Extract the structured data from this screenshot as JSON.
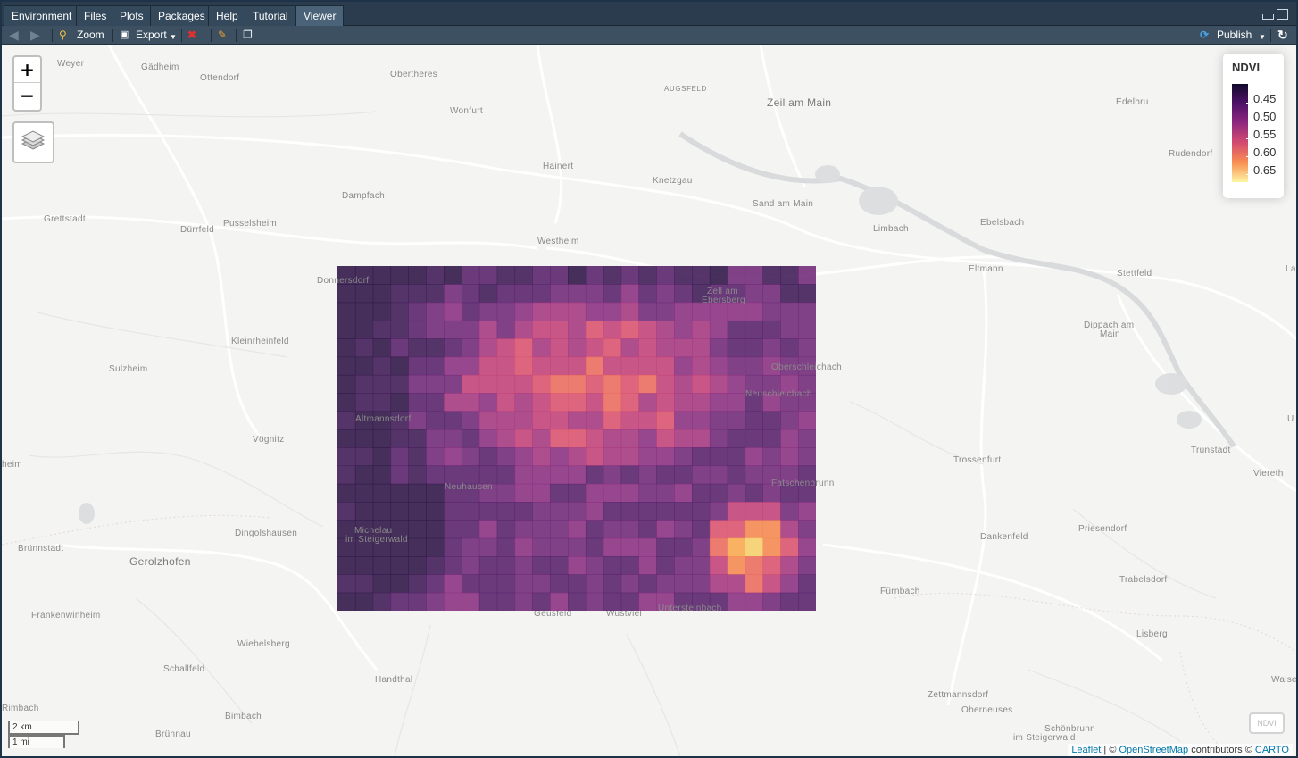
{
  "tabs": [
    {
      "label": "Environment",
      "active": false
    },
    {
      "label": "Files",
      "active": false
    },
    {
      "label": "Plots",
      "active": false
    },
    {
      "label": "Packages",
      "active": false
    },
    {
      "label": "Help",
      "active": false
    },
    {
      "label": "Tutorial",
      "active": false
    },
    {
      "label": "Viewer",
      "active": true
    }
  ],
  "toolbar": {
    "zoom_label": "Zoom",
    "export_label": "Export",
    "publish_label": "Publish"
  },
  "map": {
    "zoom_in": "+",
    "zoom_out": "−",
    "legend": {
      "title": "NDVI",
      "labels": [
        "0.45",
        "0.50",
        "0.55",
        "0.60",
        "0.65"
      ],
      "colors": [
        "#0d0887",
        "#3b0f70",
        "#8c2981",
        "#de4968",
        "#fe9f6d",
        "#fcfdbf"
      ]
    },
    "scale": {
      "metric": "2 km",
      "imperial": "1 mi"
    },
    "layer_toggle": "NDVI",
    "attribution": {
      "leaflet": "Leaflet",
      "sep": " | © ",
      "osm": "OpenStreetMap",
      "mid": " contributors © ",
      "carto": "CARTO"
    },
    "places": [
      {
        "name": "Weyer"
      },
      {
        "name": "Gädheim"
      },
      {
        "name": "Ottendorf"
      },
      {
        "name": "Obertheres"
      },
      {
        "name": "AUGSFELD"
      },
      {
        "name": "Zeil am Main"
      },
      {
        "name": "Edelbru"
      },
      {
        "name": "Wonfurt"
      },
      {
        "name": "Rudendorf"
      },
      {
        "name": "Hainert"
      },
      {
        "name": "Knetzgau"
      },
      {
        "name": "Sand am Main"
      },
      {
        "name": "Dampfach"
      },
      {
        "name": "Grettstadt"
      },
      {
        "name": "Dürrfeld"
      },
      {
        "name": "Pusselsheim"
      },
      {
        "name": "Limbach"
      },
      {
        "name": "Ebelsbach"
      },
      {
        "name": "Westheim"
      },
      {
        "name": "Eltmann"
      },
      {
        "name": "Stettfeld"
      },
      {
        "name": "Donnersdorf"
      },
      {
        "name": "Zell am"
      },
      {
        "name": "Ebersberg"
      },
      {
        "name": "Dippach am"
      },
      {
        "name": "Main"
      },
      {
        "name": "Kleinrheinfeld"
      },
      {
        "name": "Sulzheim"
      },
      {
        "name": "Oberschleichach"
      },
      {
        "name": "Neuschleichach"
      },
      {
        "name": "Altmannsdorf"
      },
      {
        "name": "Vögnitz"
      },
      {
        "name": "Trunstadt"
      },
      {
        "name": "Trossenfurt"
      },
      {
        "name": "Viereth"
      },
      {
        "name": "Neuhausen"
      },
      {
        "name": "Fatschenbrunn"
      },
      {
        "name": "Michelau"
      },
      {
        "name": "im Steigerwald"
      },
      {
        "name": "Dingolshausen"
      },
      {
        "name": "Brünnstadt"
      },
      {
        "name": "Dankenfeld"
      },
      {
        "name": "Priesendorf"
      },
      {
        "name": "Gerolzhofen"
      },
      {
        "name": "Trabelsdorf"
      },
      {
        "name": "Fürnbach"
      },
      {
        "name": "Frankenwinheim"
      },
      {
        "name": "Geusfeld"
      },
      {
        "name": "Wustviel"
      },
      {
        "name": "Untersteinbach"
      },
      {
        "name": "Wiebelsberg"
      },
      {
        "name": "Lisberg"
      },
      {
        "name": "Schallfeld"
      },
      {
        "name": "Handthal"
      },
      {
        "name": "Zettmannsdorf"
      },
      {
        "name": "Walse"
      },
      {
        "name": "Oberneuses"
      },
      {
        "name": "Rimbach"
      },
      {
        "name": "Bimbach"
      },
      {
        "name": "Schönbrunn"
      },
      {
        "name": "im Steigerwald"
      },
      {
        "name": "Brünnau"
      },
      {
        "name": "heim"
      },
      {
        "name": "La"
      },
      {
        "name": "U"
      }
    ]
  }
}
